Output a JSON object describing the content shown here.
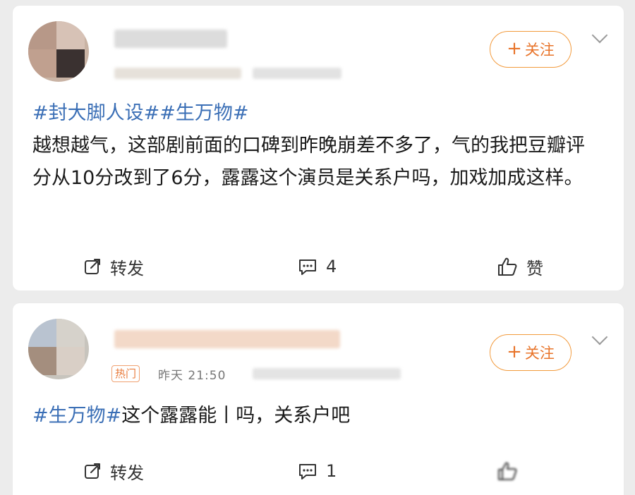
{
  "posts": [
    {
      "follow_label": "关注",
      "text_segments": [
        {
          "text": "#封大脚人设#",
          "type": "topic"
        },
        {
          "text": "#生万物#",
          "type": "topic"
        },
        {
          "text": "\n越想越气，这部剧前面的口碑到昨晚崩差不多了，气的我把豆瓣评分从10分改到了6分，露露这个演员是关系户吗，加戏加成这样。",
          "type": "text"
        }
      ],
      "actions": {
        "repost_label": "转发",
        "comment_count": "4",
        "like_label": "赞"
      }
    },
    {
      "follow_label": "关注",
      "hot_tag": "热门",
      "time_text": "昨天 21:50",
      "text_segments": [
        {
          "text": "#生万物#",
          "type": "topic"
        },
        {
          "text": "这个露露能丨吗，关系户吧",
          "type": "text"
        }
      ],
      "actions": {
        "repost_label": "转发",
        "comment_count": "1"
      }
    }
  ],
  "colors": {
    "accent": "#e8742a",
    "topic": "#3b6fb6",
    "background": "#ececec"
  },
  "icons": [
    "share-icon",
    "comment-icon",
    "like-icon",
    "chevron-down-icon",
    "plus-icon"
  ]
}
